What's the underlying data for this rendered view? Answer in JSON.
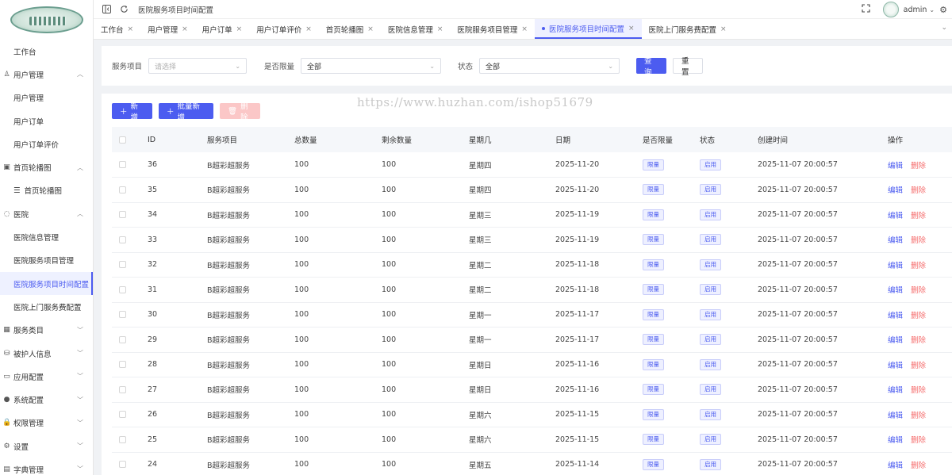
{
  "topbar": {
    "breadcrumb": "医院服务项目时间配置",
    "username": "admin"
  },
  "sidebar": {
    "items": [
      {
        "label": "工作台",
        "type": "plain"
      },
      {
        "label": "用户管理",
        "type": "group",
        "icon": "user-icon",
        "chevron": "up"
      },
      {
        "label": "用户管理",
        "type": "sub"
      },
      {
        "label": "用户订单",
        "type": "sub"
      },
      {
        "label": "用户订单评价",
        "type": "sub"
      },
      {
        "label": "首页轮播图",
        "type": "group",
        "icon": "image-icon",
        "chevron": "up"
      },
      {
        "label": "首页轮播图",
        "type": "sub-icon",
        "icon": "list-icon"
      },
      {
        "label": "医院",
        "type": "group",
        "icon": "hospital-icon",
        "chevron": "up"
      },
      {
        "label": "医院信息管理",
        "type": "sub"
      },
      {
        "label": "医院服务项目管理",
        "type": "sub"
      },
      {
        "label": "医院服务项目时间配置",
        "type": "sub",
        "active": true
      },
      {
        "label": "医院上门服务费配置",
        "type": "sub"
      },
      {
        "label": "服务类目",
        "type": "group",
        "icon": "calendar-icon",
        "chevron": "down"
      },
      {
        "label": "被护人信息",
        "type": "group",
        "icon": "database-icon",
        "chevron": "down"
      },
      {
        "label": "应用配置",
        "type": "group",
        "icon": "app-icon",
        "chevron": "down"
      },
      {
        "label": "系统配置",
        "type": "group",
        "icon": "check-circle-icon",
        "chevron": "down"
      },
      {
        "label": "权限管理",
        "type": "group",
        "icon": "lock-icon",
        "chevron": "down"
      },
      {
        "label": "设置",
        "type": "group",
        "icon": "gear-icon",
        "chevron": "down"
      },
      {
        "label": "字典管理",
        "type": "group",
        "icon": "book-icon",
        "chevron": "down"
      }
    ]
  },
  "tabs": [
    {
      "label": "工作台",
      "active": false
    },
    {
      "label": "用户管理",
      "active": false
    },
    {
      "label": "用户订单",
      "active": false
    },
    {
      "label": "用户订单评价",
      "active": false
    },
    {
      "label": "首页轮播图",
      "active": false
    },
    {
      "label": "医院信息管理",
      "active": false
    },
    {
      "label": "医院服务项目管理",
      "active": false
    },
    {
      "label": "医院服务项目时间配置",
      "active": true
    },
    {
      "label": "医院上门服务费配置",
      "active": false
    }
  ],
  "filter": {
    "service_label": "服务项目",
    "service_placeholder": "请选择",
    "limit_label": "是否限量",
    "limit_value": "全部",
    "status_label": "状态",
    "status_value": "全部",
    "query_button": "查询",
    "reset_button": "重置"
  },
  "toolbar": {
    "add_button": "新增",
    "batch_add_button": "批量新增",
    "delete_button": "删除"
  },
  "watermark": "https://www.huzhan.com/ishop51679",
  "table": {
    "columns": [
      "ID",
      "服务项目",
      "总数量",
      "剩余数量",
      "星期几",
      "日期",
      "是否限量",
      "状态",
      "创建时间",
      "操作"
    ],
    "edit_label": "编辑",
    "delete_label": "删除",
    "rows": [
      {
        "id": "36",
        "service": "B超彩超服务",
        "total": "100",
        "remain": "100",
        "weekday": "星期四",
        "date": "2025-11-20",
        "limited": "限量",
        "status": "启用",
        "created": "2025-11-07 20:00:57"
      },
      {
        "id": "35",
        "service": "B超彩超服务",
        "total": "100",
        "remain": "100",
        "weekday": "星期四",
        "date": "2025-11-20",
        "limited": "限量",
        "status": "启用",
        "created": "2025-11-07 20:00:57"
      },
      {
        "id": "34",
        "service": "B超彩超服务",
        "total": "100",
        "remain": "100",
        "weekday": "星期三",
        "date": "2025-11-19",
        "limited": "限量",
        "status": "启用",
        "created": "2025-11-07 20:00:57"
      },
      {
        "id": "33",
        "service": "B超彩超服务",
        "total": "100",
        "remain": "100",
        "weekday": "星期三",
        "date": "2025-11-19",
        "limited": "限量",
        "status": "启用",
        "created": "2025-11-07 20:00:57"
      },
      {
        "id": "32",
        "service": "B超彩超服务",
        "total": "100",
        "remain": "100",
        "weekday": "星期二",
        "date": "2025-11-18",
        "limited": "限量",
        "status": "启用",
        "created": "2025-11-07 20:00:57"
      },
      {
        "id": "31",
        "service": "B超彩超服务",
        "total": "100",
        "remain": "100",
        "weekday": "星期二",
        "date": "2025-11-18",
        "limited": "限量",
        "status": "启用",
        "created": "2025-11-07 20:00:57"
      },
      {
        "id": "30",
        "service": "B超彩超服务",
        "total": "100",
        "remain": "100",
        "weekday": "星期一",
        "date": "2025-11-17",
        "limited": "限量",
        "status": "启用",
        "created": "2025-11-07 20:00:57"
      },
      {
        "id": "29",
        "service": "B超彩超服务",
        "total": "100",
        "remain": "100",
        "weekday": "星期一",
        "date": "2025-11-17",
        "limited": "限量",
        "status": "启用",
        "created": "2025-11-07 20:00:57"
      },
      {
        "id": "28",
        "service": "B超彩超服务",
        "total": "100",
        "remain": "100",
        "weekday": "星期日",
        "date": "2025-11-16",
        "limited": "限量",
        "status": "启用",
        "created": "2025-11-07 20:00:57"
      },
      {
        "id": "27",
        "service": "B超彩超服务",
        "total": "100",
        "remain": "100",
        "weekday": "星期日",
        "date": "2025-11-16",
        "limited": "限量",
        "status": "启用",
        "created": "2025-11-07 20:00:57"
      },
      {
        "id": "26",
        "service": "B超彩超服务",
        "total": "100",
        "remain": "100",
        "weekday": "星期六",
        "date": "2025-11-15",
        "limited": "限量",
        "status": "启用",
        "created": "2025-11-07 20:00:57"
      },
      {
        "id": "25",
        "service": "B超彩超服务",
        "total": "100",
        "remain": "100",
        "weekday": "星期六",
        "date": "2025-11-15",
        "limited": "限量",
        "status": "启用",
        "created": "2025-11-07 20:00:57"
      },
      {
        "id": "24",
        "service": "B超彩超服务",
        "total": "100",
        "remain": "100",
        "weekday": "星期五",
        "date": "2025-11-14",
        "limited": "限量",
        "status": "启用",
        "created": "2025-11-07 20:00:57"
      }
    ]
  },
  "colors": {
    "primary": "#4c5cf0",
    "danger": "#f56c6c",
    "danger_disabled": "#fbc7c7"
  }
}
